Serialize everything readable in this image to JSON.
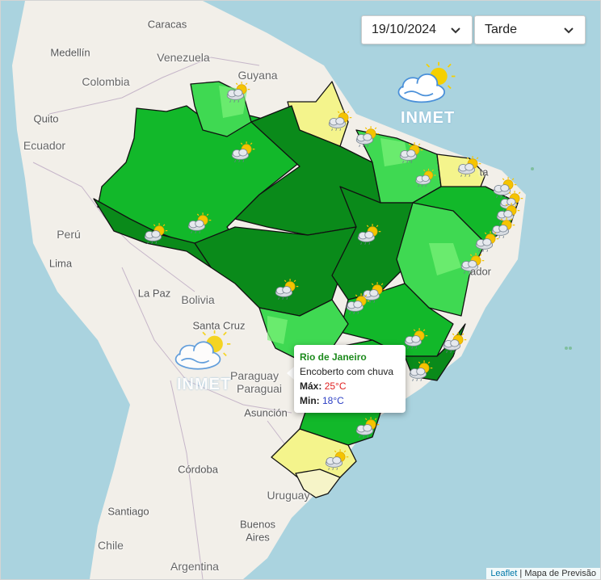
{
  "controls": {
    "date_value": "19/10/2024",
    "period_value": "Tarde"
  },
  "branding": {
    "logo_text": "INMET"
  },
  "map_labels": {
    "caracas": "Caracas",
    "medellin": "Medellín",
    "venezuela": "Venezuela",
    "guyana": "Guyana",
    "colombia": "Colombia",
    "quito": "Quito",
    "ecuador": "Ecuador",
    "peru": "Perú",
    "lima": "Lima",
    "la_paz": "La Paz",
    "bolivia": "Bolivia",
    "santa_cruz": "Santa Cruz",
    "paraguay": "Paraguay",
    "paraguai": "Paraguai",
    "asuncion": "Asunción",
    "cordoba": "Córdoba",
    "santiago": "Santiago",
    "chile": "Chile",
    "uruguay": "Uruguay",
    "buenos_aires_1": "Buenos",
    "buenos_aires_2": "Aires",
    "argentina": "Argentina",
    "salvador": "ador",
    "natal": "ta"
  },
  "popup": {
    "city": "Rio de Janeiro",
    "condition": "Encoberto com chuva",
    "max_label": "Máx:",
    "max_value": "25°C",
    "min_label": "Min:",
    "min_value": "18°C"
  },
  "attribution": {
    "leaflet": "Leaflet",
    "separator": " | ",
    "source": "Mapa de Previsão"
  },
  "colors": {
    "ocean": "#aad3df",
    "land": "#f2efe9",
    "green_dark": "#0a8a1a",
    "green_mid": "#12b82a",
    "green_light": "#3fd952",
    "green_pale": "#7df27a",
    "yellow": "#f4f48c",
    "cream": "#f6f4c8"
  },
  "icons": [
    "sun-cloud-icon",
    "sun-cloud-rain-icon",
    "cloud-rain-icon",
    "chevron-down-icon"
  ]
}
